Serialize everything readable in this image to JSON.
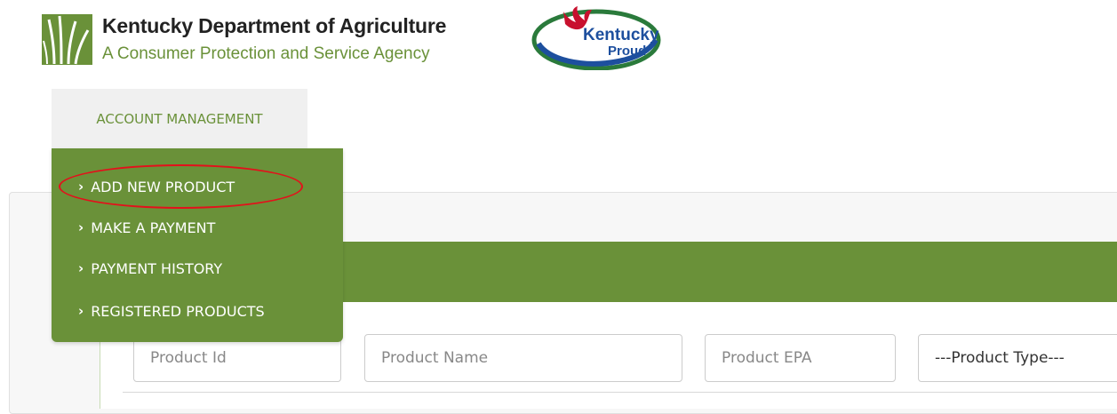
{
  "header": {
    "org_title": "Kentucky Department of Agriculture",
    "org_subtitle": "A Consumer Protection and Service Agency",
    "badge_text_top": "Kentucky",
    "badge_text_bottom": "Proud"
  },
  "nav": {
    "account_management": "ACCOUNT MANAGEMENT"
  },
  "dropdown": {
    "items": [
      {
        "label": "ADD NEW PRODUCT",
        "highlighted": true
      },
      {
        "label": "MAKE A PAYMENT"
      },
      {
        "label": "PAYMENT HISTORY"
      },
      {
        "label": "REGISTERED PRODUCTS"
      }
    ]
  },
  "search": {
    "product_id_placeholder": "Product Id",
    "product_name_placeholder": "Product Name",
    "product_epa_placeholder": "Product EPA",
    "product_type_selected": "---Product Type---"
  },
  "colors": {
    "brand_green": "#6a9139",
    "highlight_red": "#e4101b"
  }
}
